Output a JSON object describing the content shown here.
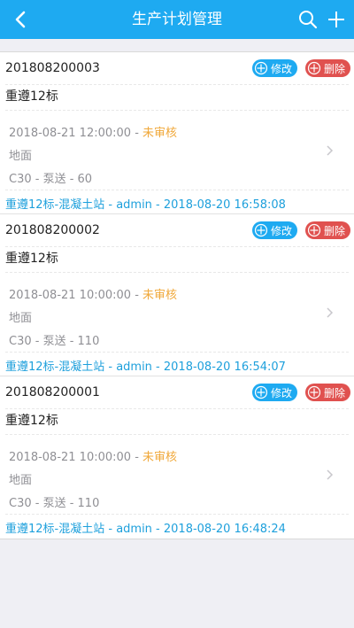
{
  "header": {
    "title": "生产计划管理"
  },
  "buttons": {
    "edit_label": "修改",
    "delete_label": "删除"
  },
  "plans": [
    {
      "code": "201808200003",
      "name": "重遵12标",
      "datetime": "2018-08-21 12:00:00",
      "status": "未审核",
      "location": "地面",
      "spec": "C30 - 泵送 - 60",
      "footer": "重遵12标-混凝土站 - admin - 2018-08-20 16:58:08"
    },
    {
      "code": "201808200002",
      "name": "重遵12标",
      "datetime": "2018-08-21 10:00:00",
      "status": "未审核",
      "location": "地面",
      "spec": "C30 - 泵送 - 110",
      "footer": "重遵12标-混凝土站 - admin - 2018-08-20 16:54:07"
    },
    {
      "code": "201808200001",
      "name": "重遵12标",
      "datetime": "2018-08-21 10:00:00",
      "status": "未审核",
      "location": "地面",
      "spec": "C30 - 泵送 - 110",
      "footer": "重遵12标-混凝土站 - admin - 2018-08-20 16:48:24"
    }
  ],
  "colors": {
    "accent": "#1eaaf1",
    "danger": "#e0514f",
    "status": "#f0a83a",
    "footer": "#1ea0dc"
  },
  "icons": {
    "back": "chevron-left-icon",
    "search": "search-icon",
    "add": "plus-icon",
    "edit": "plus-circle-icon",
    "delete": "plus-circle-icon",
    "row": "chevron-right-icon"
  }
}
